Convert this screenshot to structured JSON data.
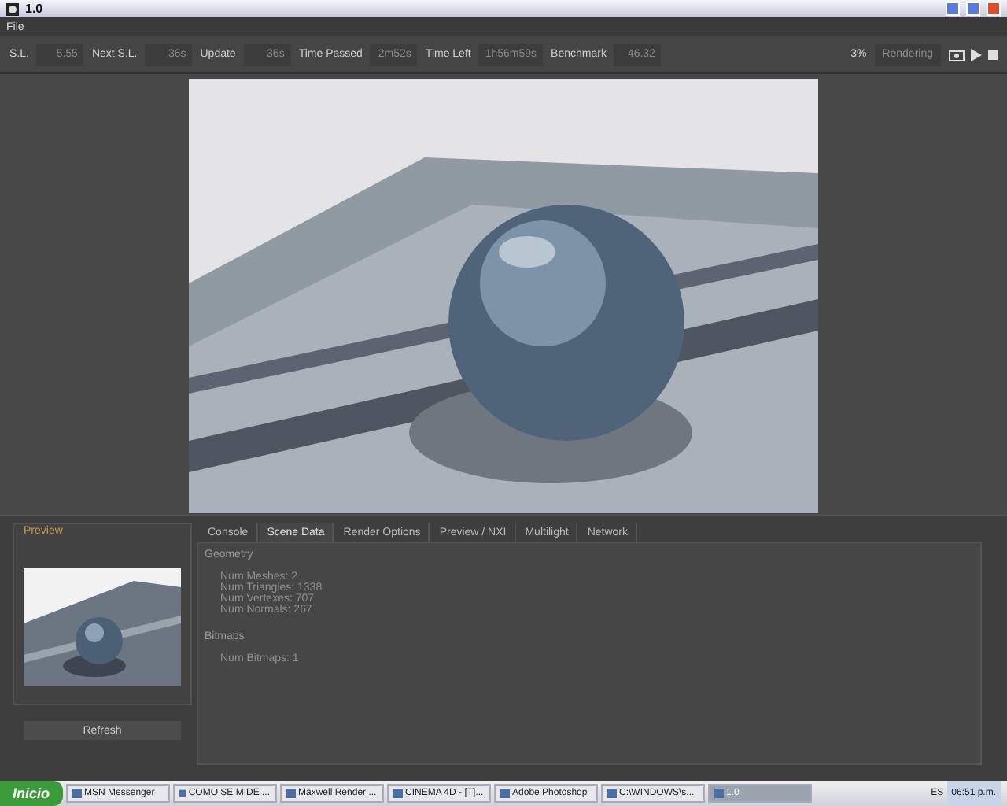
{
  "window": {
    "title": "1.0"
  },
  "menu": [
    "File"
  ],
  "stats": [
    {
      "label": "S.L.",
      "value": "5.55"
    },
    {
      "label": "Next S.L.",
      "value": "36s"
    },
    {
      "label": "Update",
      "value": "36s"
    },
    {
      "label": "Time Passed",
      "value": "2m52s"
    },
    {
      "label": "Time Left",
      "value": "1h56m59s"
    },
    {
      "label": "Benchmark",
      "value": "46.32"
    }
  ],
  "progress": "3%",
  "status": "Rendering",
  "preview": {
    "title": "Preview",
    "button": "Refresh"
  },
  "tabs": [
    {
      "label": "Console",
      "selected": false
    },
    {
      "label": "Scene Data",
      "selected": true
    },
    {
      "label": "Render Options",
      "selected": false
    },
    {
      "label": "Preview / NXI",
      "selected": false
    },
    {
      "label": "Multilight",
      "selected": false
    },
    {
      "label": "Network",
      "selected": false
    }
  ],
  "scene_data": [
    {
      "heading": "Geometry",
      "lines": [
        "Num Meshes: 2",
        "Num Triangles: 1338",
        "Num Vertexes: 707",
        "Num Normals: 267"
      ]
    },
    {
      "heading": "Bitmaps",
      "lines": [
        "Num Bitmaps: 1"
      ]
    }
  ],
  "taskbar": {
    "start": "Inicio",
    "tasks": [
      {
        "label": "MSN Messenger",
        "selected": false
      },
      {
        "label": "COMO SE MIDE ...",
        "selected": false
      },
      {
        "label": "Maxwell Render ...",
        "selected": false
      },
      {
        "label": "CINEMA 4D - [T]...",
        "selected": false
      },
      {
        "label": "Adobe Photoshop",
        "selected": false
      },
      {
        "label": "C:\\WINDOWS\\s...",
        "selected": false
      },
      {
        "label": "1.0",
        "selected": true
      }
    ],
    "language": "ES",
    "clock": "06:51 p.m."
  }
}
